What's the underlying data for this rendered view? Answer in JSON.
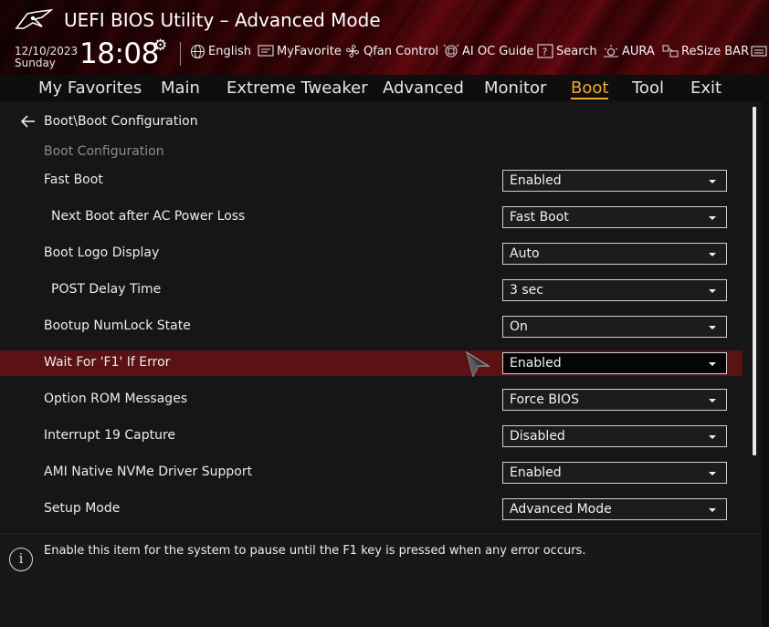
{
  "header": {
    "app_title": "UEFI BIOS Utility – Advanced Mode",
    "date": "12/10/2023",
    "day": "Sunday",
    "time": "18:08",
    "toolbar": [
      {
        "label": "English",
        "icon": "globe-icon"
      },
      {
        "label": "MyFavorite",
        "icon": "favorite-icon"
      },
      {
        "label": "Qfan Control",
        "icon": "fan-icon"
      },
      {
        "label": "AI OC Guide",
        "icon": "ai-oc-guide-icon"
      },
      {
        "label": "Search",
        "icon": "search-icon"
      },
      {
        "label": "AURA",
        "icon": "aura-icon"
      },
      {
        "label": "ReSize BAR",
        "icon": "resize-bar-icon"
      }
    ]
  },
  "nav": {
    "tabs": [
      "My Favorites",
      "Main",
      "Extreme Tweaker",
      "Advanced",
      "Monitor",
      "Boot",
      "Tool",
      "Exit"
    ],
    "active": "Boot"
  },
  "main": {
    "breadcrumb": "Boot\\Boot Configuration",
    "section_title": "Boot Configuration",
    "settings": [
      {
        "label": "Fast Boot",
        "value": "Enabled"
      },
      {
        "label": "Next Boot after AC Power Loss",
        "value": "Fast Boot"
      },
      {
        "label": "Boot Logo Display",
        "value": "Auto"
      },
      {
        "label": "POST Delay Time",
        "value": "3 sec"
      },
      {
        "label": "Bootup NumLock State",
        "value": "On"
      },
      {
        "label": "Wait For 'F1' If Error",
        "value": "Enabled"
      },
      {
        "label": "Option ROM Messages",
        "value": "Force BIOS"
      },
      {
        "label": "Interrupt 19 Capture",
        "value": "Disabled"
      },
      {
        "label": "AMI Native NVMe Driver Support",
        "value": "Enabled"
      },
      {
        "label": "Setup Mode",
        "value": "Advanced Mode"
      }
    ]
  },
  "help": {
    "text": "Enable this item for the system to pause until the F1 key is pressed when any error occurs."
  },
  "colors": {
    "accent": "#f0a830",
    "selected_row": "#5a1214",
    "header_red": "#5a0a0f"
  }
}
